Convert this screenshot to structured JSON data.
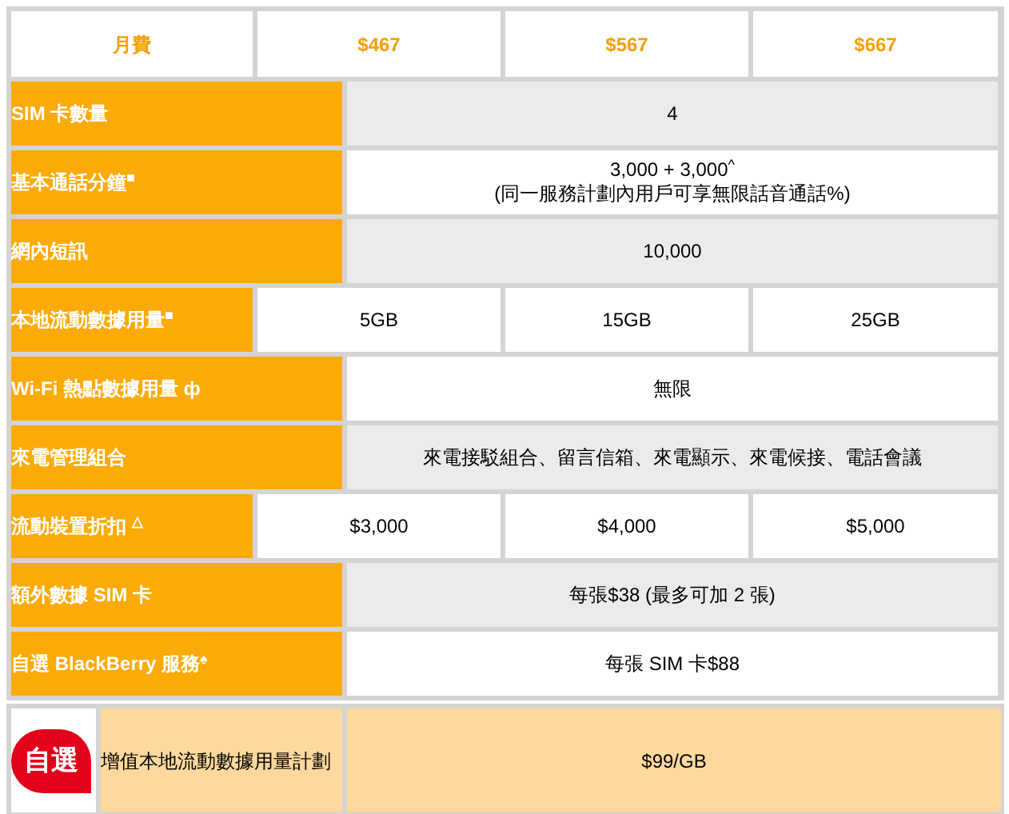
{
  "header": {
    "label": "月費",
    "plans": [
      "$467",
      "$567",
      "$667"
    ]
  },
  "rows": [
    {
      "label": "SIM 卡數量",
      "kind": "merged",
      "shaded": true,
      "values": [
        "4"
      ]
    },
    {
      "label": "基本通話分鐘$^{■}$",
      "kind": "merged",
      "shaded": false,
      "values": [
        "3,000 + 3,000$^{^}$",
        "(同一服務計劃內用戶可享無限話音通話%)"
      ]
    },
    {
      "label": "網內短訊",
      "kind": "merged",
      "shaded": true,
      "values": [
        "10,000"
      ]
    },
    {
      "label": "本地流動數據用量$^{■}$",
      "kind": "split",
      "shaded": false,
      "values": [
        "5GB",
        "15GB",
        "25GB"
      ]
    },
    {
      "label": "Wi-Fi 熱點數據用量 ф",
      "kind": "merged",
      "shaded": false,
      "values": [
        "無限"
      ]
    },
    {
      "label": "來電管理組合",
      "kind": "merged",
      "shaded": true,
      "values": [
        "來電接駁組合、留言信箱、來電顯示、來電候接、電話會議"
      ]
    },
    {
      "label": "流動裝置折扣 $^{△}$",
      "kind": "split",
      "shaded": false,
      "values": [
        "$3,000",
        "$4,000",
        "$5,000"
      ]
    },
    {
      "label": "額外數據 SIM 卡",
      "kind": "merged",
      "shaded": true,
      "values": [
        "每張$38 (最多可加 2 張)"
      ]
    },
    {
      "label": "自選 BlackBerry 服務$^{♠}$",
      "kind": "merged",
      "shaded": false,
      "values": [
        "每張 SIM 卡$88"
      ]
    }
  ],
  "addon": {
    "badge": "自選",
    "label": "增值本地流動數據用量計劃",
    "value": "$99/GB"
  }
}
